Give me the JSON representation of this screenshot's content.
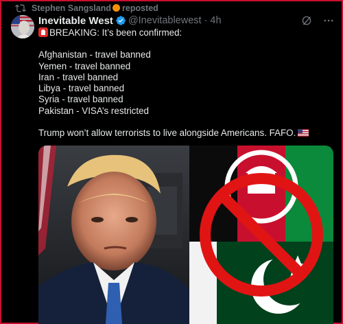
{
  "repost": {
    "text": "Stephen Sangsland",
    "suffix": "reposted"
  },
  "author": {
    "name": "Inevitable West",
    "handle": "@Inevitablewest",
    "separator": "·",
    "time": "4h"
  },
  "post": {
    "headline": "BREAKING: It’s been confirmed:",
    "lines": [
      "Afghanistan - travel banned",
      "Yemen - travel banned",
      "Iran - travel banned",
      "Libya - travel banned",
      "Syria - travel banned",
      "Pakistan - VISA’s restricted"
    ],
    "closing": "Trump won’t allow terrorists to live alongside Americans. FAFO."
  },
  "icons": {
    "repost": "repost-icon",
    "verified": "verified-badge-icon",
    "grok": "grok-icon",
    "more": "more-options-icon",
    "siren": "siren-emoji",
    "flag": "us-flag-emoji"
  },
  "colors": {
    "accent": "#1d9bf0",
    "frame": "#c8102e",
    "muted": "#71767b",
    "text": "#e7e9ea"
  }
}
